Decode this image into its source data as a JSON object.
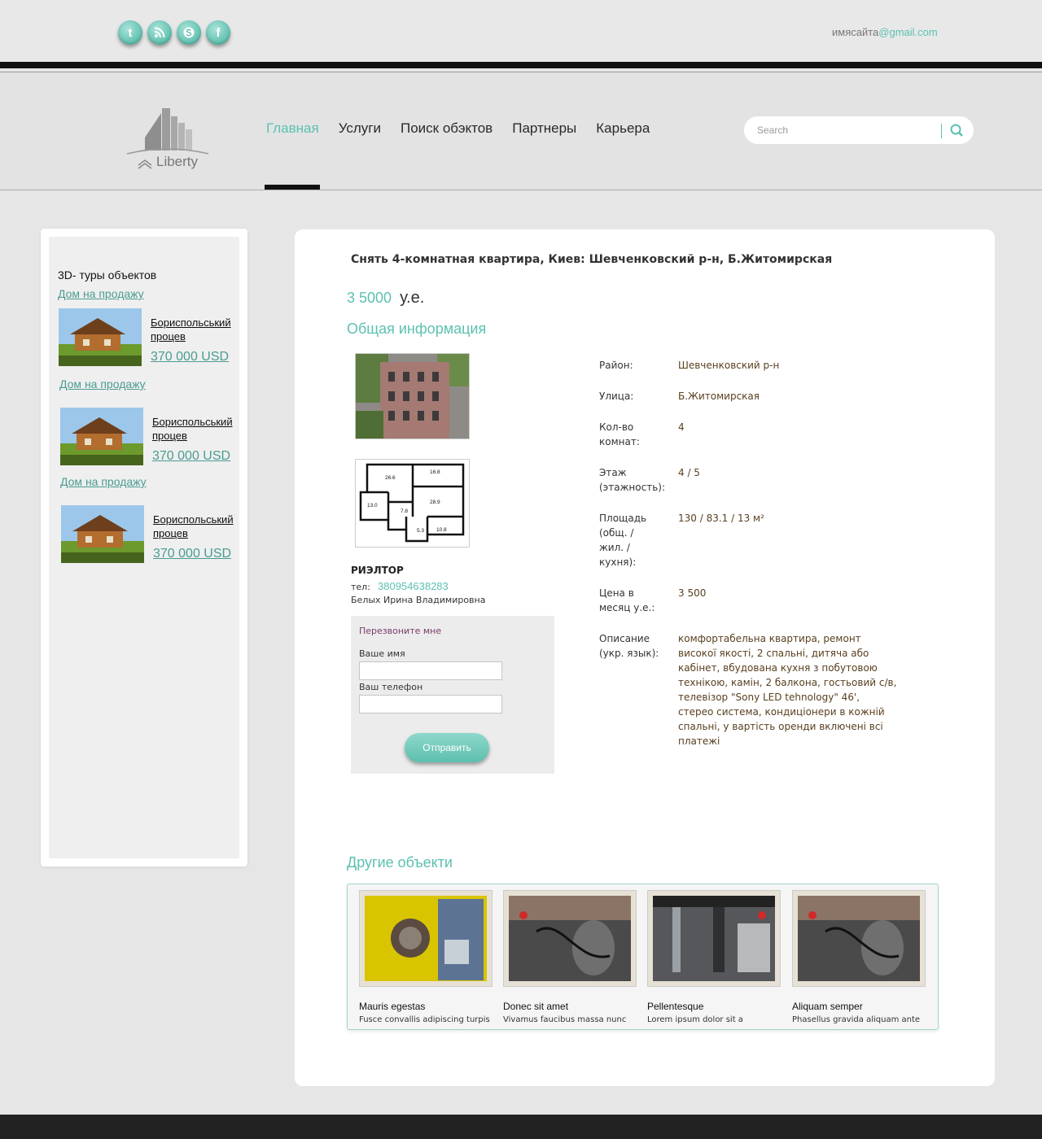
{
  "social": [
    "twitter-icon",
    "rss-icon",
    "skype-icon",
    "facebook-icon"
  ],
  "email": {
    "user": "имясайта",
    "domain": "@gmail.com"
  },
  "logo": {
    "text": "Liberty"
  },
  "nav": [
    "Главная",
    "Услуги",
    "Поиск обэктов",
    "Партнеры",
    "Карьера"
  ],
  "search": {
    "placeholder": "Search"
  },
  "sidebar": {
    "title": "3D- туры объектов",
    "items": [
      {
        "link": "Дом на продажу",
        "name": "Бориспольський процев",
        "price": "370 000 USD"
      },
      {
        "link": "Дом на продажу",
        "name": "Бориспольський процев",
        "price": "370 000 USD"
      },
      {
        "link": "Дом на продажу",
        "name": "Бориспольський процев",
        "price": "370 000 USD"
      }
    ]
  },
  "listing": {
    "title": "Снять 4-комнатная квартира, Киев: Шевченковский р-н, Б.Житомирская",
    "price_value": "3 5000",
    "price_unit": "у.е.",
    "general_info": "Общая информация",
    "plan_rooms": [
      "26.6",
      "16.8",
      "28.9",
      "13.0",
      "7.8",
      "5.3",
      "10.8"
    ],
    "realtor": {
      "heading": "РИЭЛТОР",
      "tel_label": "тел:",
      "phone": "380954638283",
      "name": "Белых Ирина Владимировна"
    },
    "callback": {
      "title": "Перезвоните мне",
      "name_label": "Ваше имя",
      "phone_label": "Ваш телефон",
      "submit": "Отправить"
    },
    "details": [
      {
        "label": "Район:",
        "value": "Шевченковский р-н"
      },
      {
        "label": "Улица:",
        "value": "Б.Житомирская"
      },
      {
        "label": "Кол-во комнат:",
        "value": "4"
      },
      {
        "label": "Этаж (этажность):",
        "value": "4 / 5"
      },
      {
        "label": "Площадь (общ. / жил. / кухня):",
        "value": "130 / 83.1 / 13 м²"
      },
      {
        "label": "Цена в месяц у.е.:",
        "value": "3 500"
      },
      {
        "label": "Описание (укр. язык):",
        "value": "комфортабельна квартира, ремонт високої якості, 2 спальні, дитяча або кабінет, вбудована кухня з побутовою технікою, камін, 2 балкона, гостьовий с/в, телевізор \"Sony LED tehnology\" 46', стерео система, кондиціонери в кожній спальні, у вартість оренди включені всі платежі"
      }
    ],
    "others_title": "Другие объекти",
    "others": [
      {
        "title": "Mauris egestas",
        "desc": "Fusce convallis adipiscing turpis"
      },
      {
        "title": "Donec sit amet",
        "desc": "Vivamus faucibus massa nunc"
      },
      {
        "title": "Pellentesque",
        "desc": "Lorem ipsum dolor sit a"
      },
      {
        "title": "Aliquam semper",
        "desc": "Phasellus gravida aliquam ante"
      }
    ]
  },
  "colors": {
    "accent": "#5cc1b1",
    "link": "#4a9c91",
    "dark": "#111111"
  }
}
